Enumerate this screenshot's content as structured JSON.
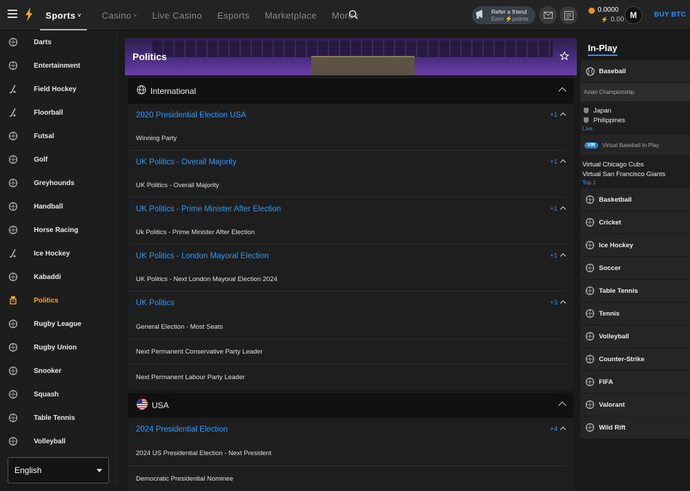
{
  "topbar": {
    "nav": [
      {
        "label": "Sports",
        "caret": true,
        "active": true
      },
      {
        "label": "Casino",
        "caret": true
      },
      {
        "label": "Live Casino"
      },
      {
        "label": "Esports"
      },
      {
        "label": "Marketplace"
      },
      {
        "label": "More",
        "caret": true
      }
    ],
    "refer_line1": "Refer a friend",
    "refer_line2": "Earn ⚡points",
    "balance_btc": "0.0000",
    "balance_points": "0.00",
    "avatar_initial": "M",
    "buy_label": "BUY BTC"
  },
  "sidebar": {
    "items": [
      {
        "label": "Darts",
        "icon": "darts-icon"
      },
      {
        "label": "Entertainment",
        "icon": "entertainment-icon"
      },
      {
        "label": "Field Hockey",
        "icon": "field-hockey-icon"
      },
      {
        "label": "Floorball",
        "icon": "floorball-icon"
      },
      {
        "label": "Futsal",
        "icon": "futsal-icon"
      },
      {
        "label": "Golf",
        "icon": "golf-icon"
      },
      {
        "label": "Greyhounds",
        "icon": "greyhounds-icon"
      },
      {
        "label": "Handball",
        "icon": "handball-icon"
      },
      {
        "label": "Horse Racing",
        "icon": "horse-racing-icon"
      },
      {
        "label": "Ice Hockey",
        "icon": "ice-hockey-icon"
      },
      {
        "label": "Kabaddi",
        "icon": "kabaddi-icon"
      },
      {
        "label": "Politics",
        "icon": "politics-icon",
        "active": true
      },
      {
        "label": "Rugby League",
        "icon": "rugby-league-icon"
      },
      {
        "label": "Rugby Union",
        "icon": "rugby-union-icon"
      },
      {
        "label": "Snooker",
        "icon": "snooker-icon"
      },
      {
        "label": "Squash",
        "icon": "squash-icon"
      },
      {
        "label": "Table Tennis",
        "icon": "table-tennis-icon"
      },
      {
        "label": "Volleyball",
        "icon": "volleyball-icon"
      }
    ],
    "language": "English"
  },
  "main": {
    "title": "Politics",
    "groups": [
      {
        "name": "International",
        "icon": "globe-icon",
        "competitions": [
          {
            "title": "2020 Presidential Election USA",
            "count": "+1",
            "markets": [
              "Winning Party"
            ]
          },
          {
            "title": "UK Politics - Overall Majority",
            "count": "+1",
            "markets": [
              "UK Politics - Overall Majority"
            ]
          },
          {
            "title": "UK Politics - Prime Minister After Election",
            "count": "+1",
            "markets": [
              "Uk Politics - Prime Minister After Election"
            ]
          },
          {
            "title": "UK Politics - London Mayoral Election",
            "count": "+1",
            "markets": [
              "UK Politics - Next London Mayoral Election 2024"
            ]
          },
          {
            "title": "UK Politics",
            "count": "+3",
            "markets": [
              "General Election - Most Seats",
              "Next Permanent Conservative Party Leader",
              "Next Permanent Labour Party Leader"
            ]
          }
        ]
      },
      {
        "name": "USA",
        "icon": "us-flag-icon",
        "competitions": [
          {
            "title": "2024 Presidential Election",
            "count": "+4",
            "markets": [
              "2024 US Presidential Election - Next President",
              "Democratic Presidential Nominee"
            ]
          }
        ]
      }
    ]
  },
  "inplay": {
    "title": "In-Play",
    "baseball": {
      "label": "Baseball",
      "league": "Asian Championship",
      "team1": "Japan",
      "team2": "Philippines",
      "status": "Live",
      "vir_badge": "VIR",
      "vir_league": "Virtual Baseball In-Play",
      "vteam1": "Virtual Chicago Cubs",
      "vteam2": "Virtual San Francisco Giants",
      "vstatus": "Top 1"
    },
    "sports": [
      {
        "label": "Basketball",
        "icon": "basketball-icon"
      },
      {
        "label": "Cricket",
        "icon": "cricket-icon"
      },
      {
        "label": "Ice Hockey",
        "icon": "ice-hockey-icon"
      },
      {
        "label": "Soccer",
        "icon": "soccer-icon"
      },
      {
        "label": "Table Tennis",
        "icon": "table-tennis-icon"
      },
      {
        "label": "Tennis",
        "icon": "tennis-icon"
      },
      {
        "label": "Volleyball",
        "icon": "volleyball-icon"
      },
      {
        "label": "Counter-Strike",
        "icon": "counter-strike-icon"
      },
      {
        "label": "FIFA",
        "icon": "fifa-icon"
      },
      {
        "label": "Valorant",
        "icon": "valorant-icon"
      },
      {
        "label": "Wild Rift",
        "icon": "wild-rift-icon"
      }
    ]
  },
  "colors": {
    "accent": "#2b9af3",
    "active": "#f5a623"
  }
}
